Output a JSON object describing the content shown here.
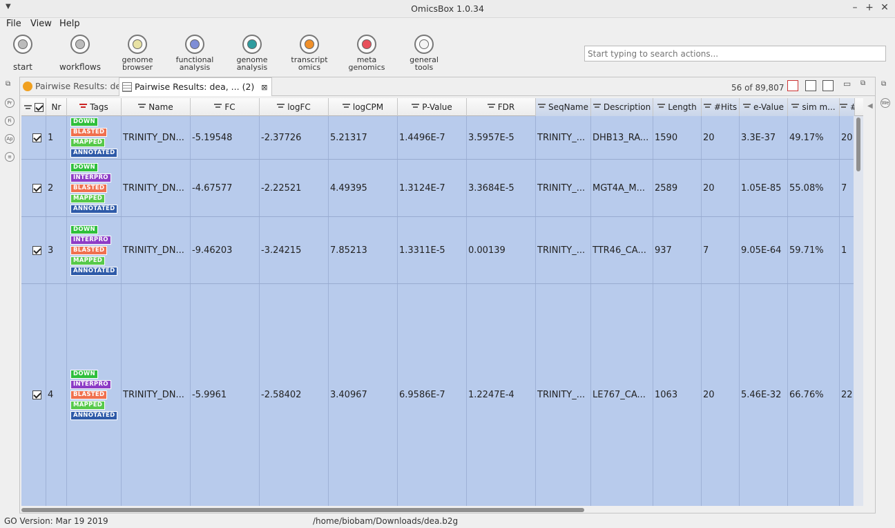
{
  "window": {
    "title": "OmicsBox 1.0.34"
  },
  "menu": [
    "File",
    "View",
    "Help"
  ],
  "toolbar": {
    "items": [
      {
        "line1": "start",
        "line2": "",
        "icon": "start-icon",
        "color": "#bbbbbb"
      },
      {
        "line1": "workflows",
        "line2": "",
        "icon": "workflows-icon",
        "color": "#bbbbbb"
      },
      {
        "line1": "genome",
        "line2": "browser",
        "icon": "genome-browser-icon",
        "color": "#e8e2a4"
      },
      {
        "line1": "functional",
        "line2": "analysis",
        "icon": "functional-analysis-icon",
        "color": "#7f8ed6"
      },
      {
        "line1": "genome",
        "line2": "analysis",
        "icon": "genome-analysis-icon",
        "color": "#2f9c9f"
      },
      {
        "line1": "transcript",
        "line2": "omics",
        "icon": "transcriptomics-icon",
        "color": "#f0902a"
      },
      {
        "line1": "meta",
        "line2": "genomics",
        "icon": "metagenomics-icon",
        "color": "#e8505b"
      },
      {
        "line1": "general",
        "line2": "tools",
        "icon": "general-tools-icon",
        "color": "#f4f4f4"
      }
    ]
  },
  "search": {
    "placeholder": "Start typing to search actions..."
  },
  "tabs": [
    {
      "label": "Pairwise Results: dea",
      "active": false
    },
    {
      "label": "Pairwise Results: dea, ... (2)",
      "active": true
    }
  ],
  "result_count": "56 of 89,807",
  "columns": [
    "Nr",
    "Tags",
    "Name",
    "FC",
    "logFC",
    "logCPM",
    "P-Value",
    "FDR",
    "SeqName",
    "Description",
    "Length",
    "#Hits",
    "e-Value",
    "sim m...",
    "#"
  ],
  "rows": [
    {
      "nr": "1",
      "tags": [
        "DOWN",
        "BLASTED",
        "MAPPED",
        "ANNOTATED"
      ],
      "name": "TRINITY_DN...",
      "fc": "-5.19548",
      "logfc": "-2.37726",
      "logcpm": "5.21317",
      "pvalue": "1.4496E-7",
      "fdr": "3.5957E-5",
      "seqname": "TRINITY_...",
      "description": "DHB13_RA...",
      "length": "1590",
      "hits": "20",
      "evalue": "3.3E-37",
      "sim": "49.17%",
      "extra": "20"
    },
    {
      "nr": "2",
      "tags": [
        "DOWN",
        "INTERPRO",
        "BLASTED",
        "MAPPED",
        "ANNOTATED"
      ],
      "name": "TRINITY_DN...",
      "fc": "-4.67577",
      "logfc": "-2.22521",
      "logcpm": "4.49395",
      "pvalue": "1.3124E-7",
      "fdr": "3.3684E-5",
      "seqname": "TRINITY_...",
      "description": "MGT4A_M...",
      "length": "2589",
      "hits": "20",
      "evalue": "1.05E-85",
      "sim": "55.08%",
      "extra": "7"
    },
    {
      "nr": "3",
      "tags": [
        "DOWN",
        "INTERPRO",
        "BLASTED",
        "MAPPED",
        "ANNOTATED"
      ],
      "name": "TRINITY_DN...",
      "fc": "-9.46203",
      "logfc": "-3.24215",
      "logcpm": "7.85213",
      "pvalue": "1.3311E-5",
      "fdr": "0.00139",
      "seqname": "TRINITY_...",
      "description": "TTR46_CA...",
      "length": "937",
      "hits": "7",
      "evalue": "9.05E-64",
      "sim": "59.71%",
      "extra": "1"
    },
    {
      "nr": "4",
      "tags": [
        "DOWN",
        "INTERPRO",
        "BLASTED",
        "MAPPED",
        "ANNOTATED"
      ],
      "name": "TRINITY_DN...",
      "fc": "-5.9961",
      "logfc": "-2.58402",
      "logcpm": "3.40967",
      "pvalue": "6.9586E-7",
      "fdr": "1.2247E-4",
      "seqname": "TRINITY_...",
      "description": "LE767_CA...",
      "length": "1063",
      "hits": "20",
      "evalue": "5.46E-32",
      "sim": "66.76%",
      "extra": "22"
    }
  ],
  "left_strip": [
    "Pr",
    "Fi",
    "Ap"
  ],
  "right_strip": [
    "We"
  ],
  "status": {
    "left": "GO Version: Mar 19 2019",
    "path": "/home/biobam/Downloads/dea.b2g"
  },
  "colors": {
    "selection": "#b8cbec",
    "down": "#2fbf3c",
    "interpro": "#8d3cc6",
    "blasted": "#f0704e",
    "mapped": "#57c94a",
    "annotated": "#2e5aa8"
  }
}
